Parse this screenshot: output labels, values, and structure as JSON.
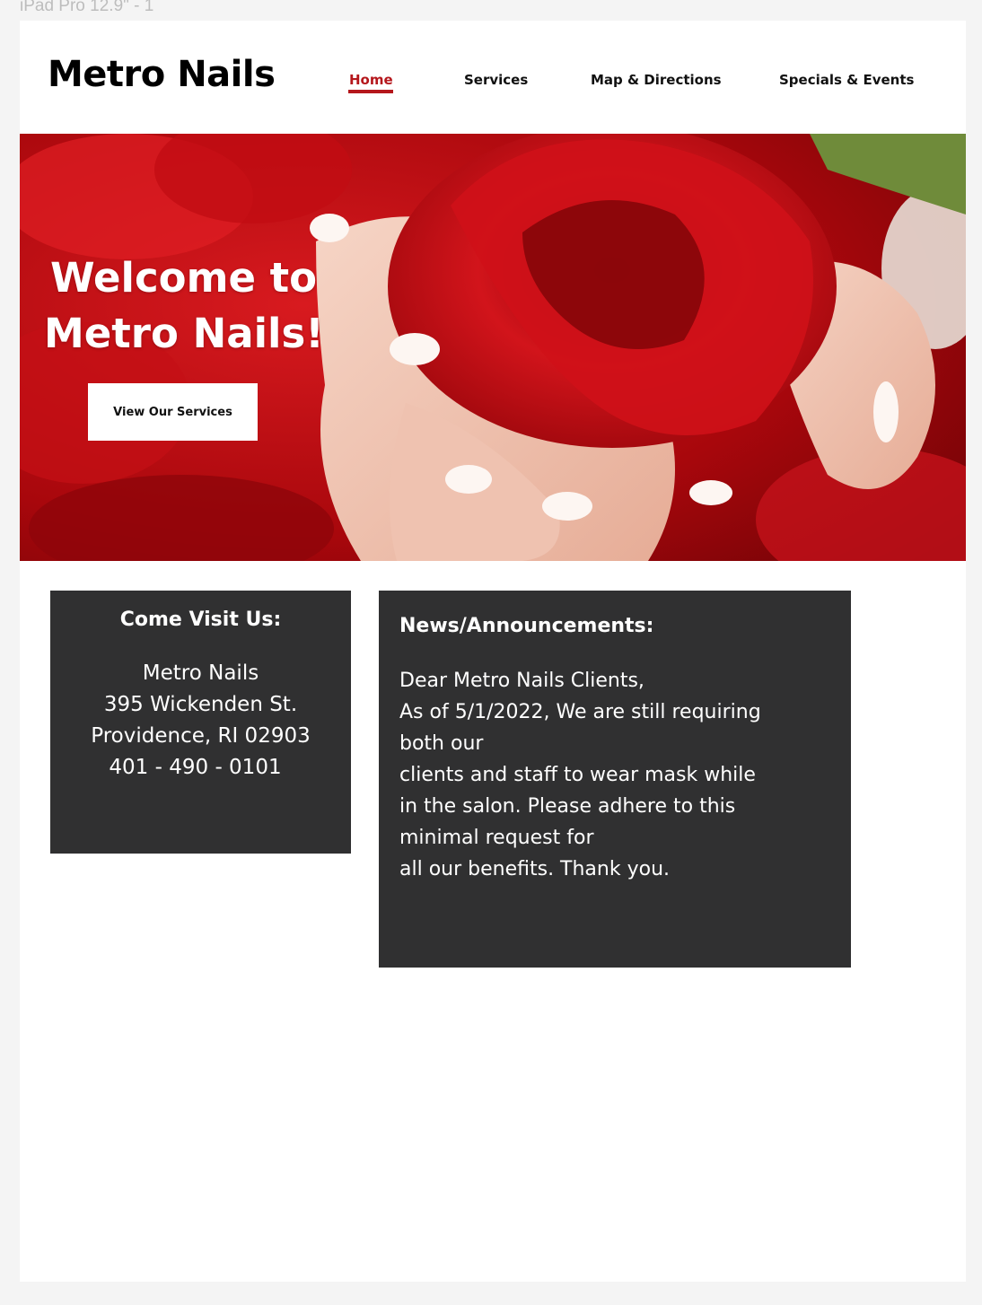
{
  "frame_label": "iPad Pro 12.9\" - 1",
  "brand": {
    "name": "Metro Nails",
    "accent": "#b5171c"
  },
  "nav": {
    "items": [
      {
        "label": "Home",
        "active": true
      },
      {
        "label": "Services",
        "active": false
      },
      {
        "label": "Map & Directions",
        "active": false
      },
      {
        "label": "Specials & Events",
        "active": false
      }
    ]
  },
  "hero": {
    "title_line1": "Welcome to",
    "title_line2": "Metro Nails!",
    "cta_label": "View Our Services"
  },
  "visit": {
    "heading": "Come Visit Us:",
    "lines": [
      "Metro Nails",
      "395 Wickenden St.",
      "Providence, RI 02903",
      "401 - 490 - 0101"
    ]
  },
  "news": {
    "heading": "News/Announcements:",
    "lines": [
      "Dear Metro Nails Clients,",
      "As of 5/1/2022, We are still requiring",
      "both our",
      "clients and staff to wear mask while",
      "in the salon. Please adhere to this",
      "minimal request for",
      "all our benefits. Thank you."
    ]
  },
  "colors": {
    "card_bg": "#303031",
    "hero_red": "#b4080f"
  }
}
